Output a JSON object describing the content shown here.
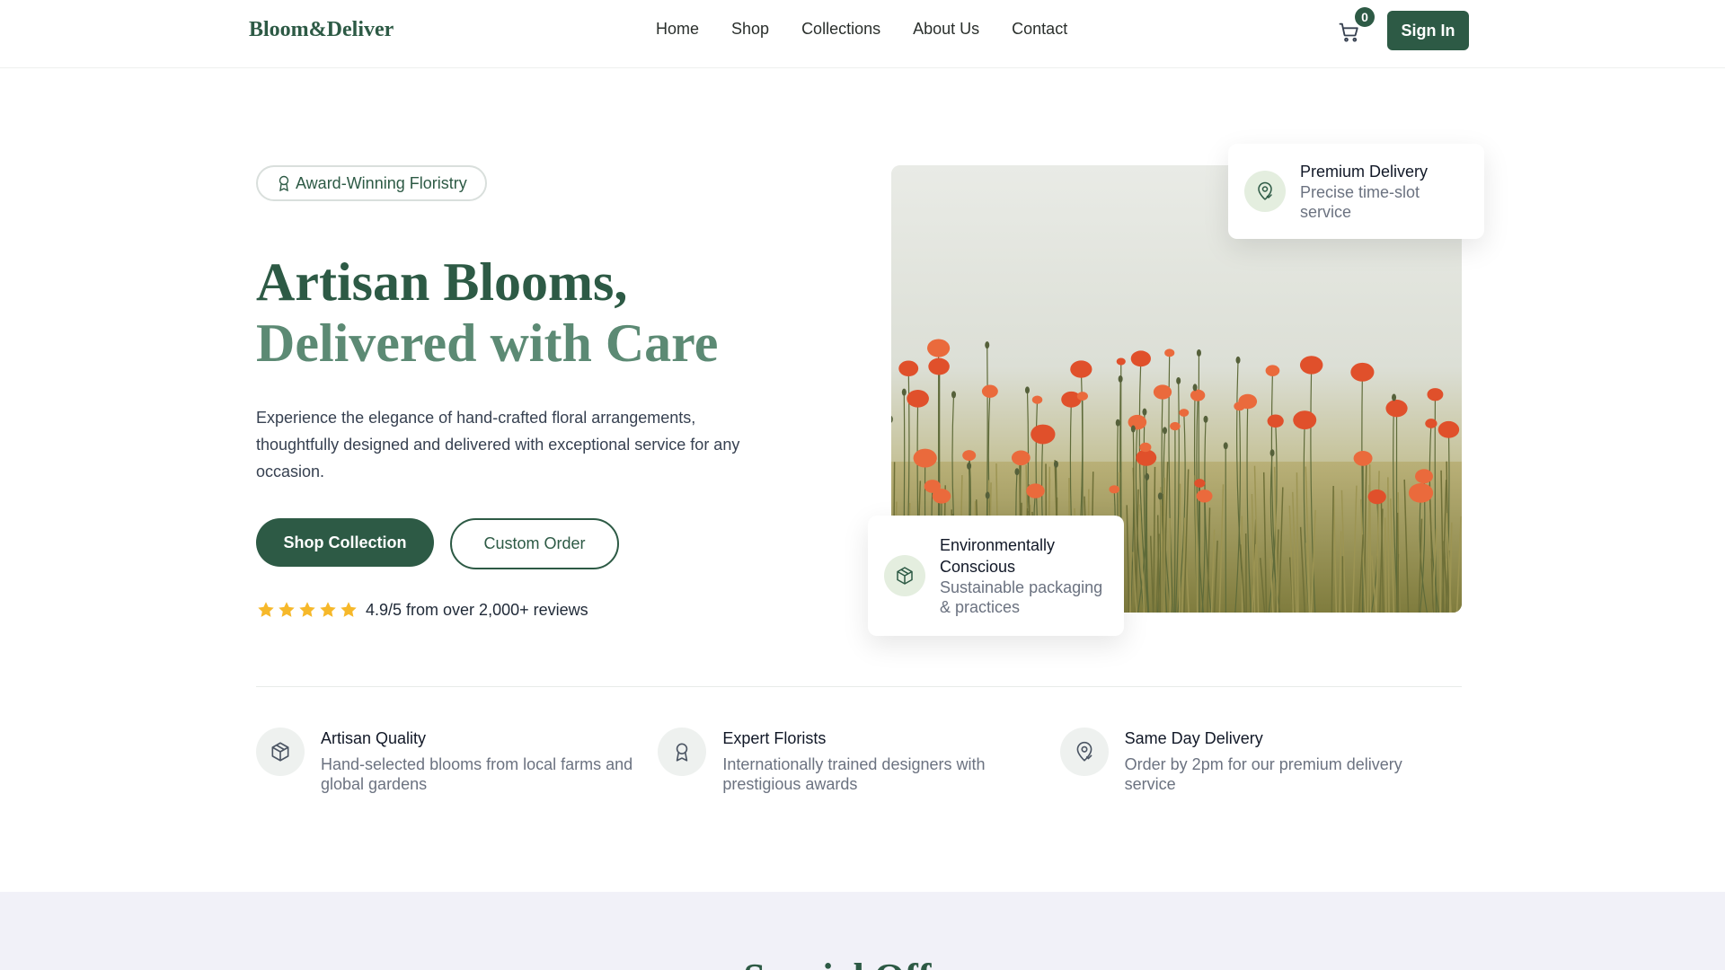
{
  "brand": {
    "name": "Bloom&Deliver",
    "primary_color": "#2d5a45",
    "secondary_color": "#5c8a74"
  },
  "nav": {
    "links": [
      "Home",
      "Shop",
      "Collections",
      "About Us",
      "Contact"
    ],
    "cart_count": "0",
    "signin_label": "Sign In"
  },
  "hero": {
    "badge": "Award-Winning Floristry",
    "title_line1": "Artisan Blooms,",
    "title_line2": "Delivered with Care",
    "lead": "Experience the elegance of hand-crafted floral arrangements, thoughtfully designed and delivered with exceptional service for any occasion.",
    "primary_cta": "Shop Collection",
    "secondary_cta": "Custom Order",
    "rating_text": "4.9/5 from over 2,000+ reviews",
    "rating_stars": 5,
    "star_color": "#f6b82a"
  },
  "cards": {
    "delivery": {
      "title": "Premium Delivery",
      "subtitle": "Precise time-slot service",
      "icon": "location-pin-icon"
    },
    "eco": {
      "title": "Environmentally Conscious",
      "subtitle": "Sustainable packaging & practices",
      "icon": "box-icon"
    }
  },
  "features": [
    {
      "title": "Artisan Quality",
      "desc": "Hand-selected blooms from local farms and global gardens",
      "icon": "box-icon"
    },
    {
      "title": "Expert Florists",
      "desc": "Internationally trained designers with prestigious awards",
      "icon": "award-icon"
    },
    {
      "title": "Same Day Delivery",
      "desc": "Order by 2pm for our premium delivery service",
      "icon": "location-pin-icon"
    }
  ],
  "offers": {
    "title": "Special Offers"
  }
}
